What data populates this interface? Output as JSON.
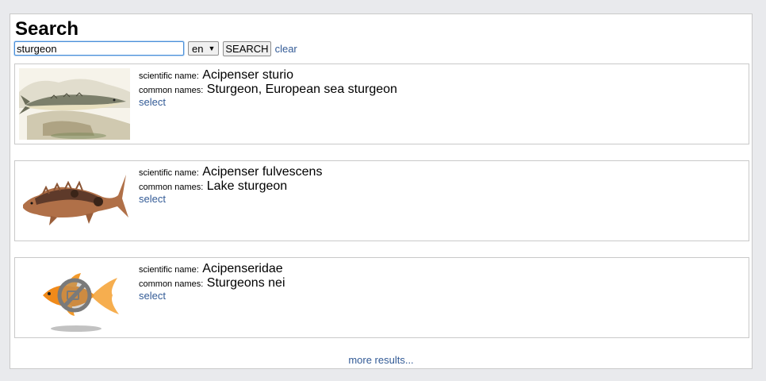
{
  "page": {
    "title": "Search"
  },
  "search": {
    "query": "sturgeon",
    "language": "en",
    "button_label": "SEARCH",
    "clear_label": "clear"
  },
  "labels": {
    "scientific": "scientific name:",
    "common": "common names:",
    "select": "select"
  },
  "results": [
    {
      "scientific_name": "Acipenser sturio",
      "common_names": "Sturgeon, European sea sturgeon",
      "image_icon": "sturgeon-illustration-icon"
    },
    {
      "scientific_name": "Acipenser fulvescens",
      "common_names": "Lake sturgeon",
      "image_icon": "lake-sturgeon-icon"
    },
    {
      "scientific_name": "Acipenseridae",
      "common_names": "Sturgeons nei",
      "image_icon": "no-photo-goldfish-icon"
    }
  ],
  "more_label": "more results..."
}
